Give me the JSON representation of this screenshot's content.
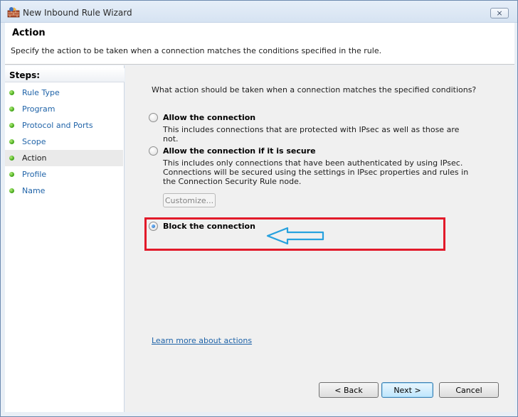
{
  "window": {
    "title": "New Inbound Rule Wizard",
    "close_glyph": "⨯"
  },
  "header": {
    "title": "Action",
    "description": "Specify the action to be taken when a connection matches the conditions specified in the rule."
  },
  "steps": {
    "heading": "Steps:",
    "items": [
      {
        "label": "Rule Type"
      },
      {
        "label": "Program"
      },
      {
        "label": "Protocol and Ports"
      },
      {
        "label": "Scope"
      },
      {
        "label": "Action"
      },
      {
        "label": "Profile"
      },
      {
        "label": "Name"
      }
    ],
    "current_index": 4
  },
  "main": {
    "question": "What action should be taken when a connection matches the specified conditions?",
    "options": [
      {
        "label": "Allow the connection",
        "description": "This includes connections that are protected with IPsec as well as those are not.",
        "checked": false
      },
      {
        "label": "Allow the connection if it is secure",
        "description": "This includes only connections that have been authenticated by using IPsec.  Connections will be secured using the settings in IPsec properties and rules in the Connection Security Rule node.",
        "checked": false
      },
      {
        "label": "Block the connection",
        "description": "",
        "checked": true
      }
    ],
    "customize_label": "Customize...",
    "learn_more": "Learn more about actions"
  },
  "buttons": {
    "back": "< Back",
    "next": "Next >",
    "cancel": "Cancel"
  },
  "colors": {
    "highlight": "#e21a2a",
    "arrow": "#27a1de",
    "link": "#1f63a8"
  },
  "icons": {
    "title": "firewall-icon",
    "arrow": "arrow-left-icon"
  }
}
